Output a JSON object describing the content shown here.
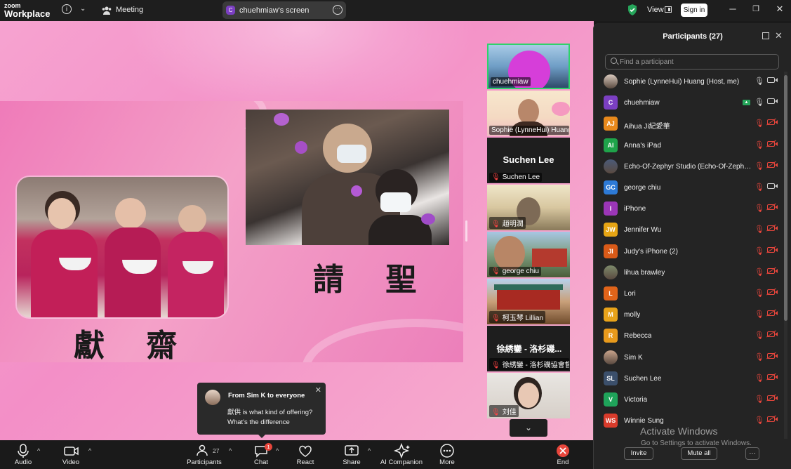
{
  "titlebar": {
    "logo_top": "zoom",
    "logo_bottom": "Workplace",
    "meeting_label": "Meeting",
    "screen_owner_initial": "C",
    "screen_label": "chuehmiaw's screen",
    "view_label": "View",
    "signin_label": "Sign in"
  },
  "slide": {
    "caption_left": "獻 齋",
    "caption_right": "請 聖"
  },
  "video_tiles": [
    {
      "name": "chuehmiaw",
      "muted": false
    },
    {
      "name": "Sophie (LynneHui) Huang",
      "muted": false
    },
    {
      "name": "Suchen Lee",
      "muted": true,
      "big_text": "Suchen Lee"
    },
    {
      "name": "趙明潤",
      "muted": true
    },
    {
      "name": "george chiu",
      "muted": true
    },
    {
      "name": "柯玉琴 Lillian",
      "muted": true
    },
    {
      "name": "徐綉鑾 - 洛杉磯協會督...",
      "muted": true,
      "big_text": "徐綉鑾 - 洛杉磯..."
    },
    {
      "name": "刘佳",
      "muted": true
    }
  ],
  "chat_toast": {
    "from": "From Sim K to everyone",
    "message": "獻供 is what kind of offering? What's the difference"
  },
  "toolbar": {
    "audio": "Audio",
    "video": "Video",
    "participants": "Participants",
    "participants_count": "27",
    "chat": "Chat",
    "chat_badge": "1",
    "react": "React",
    "share": "Share",
    "ai_companion": "AI Companion",
    "more": "More",
    "end": "End"
  },
  "participants_panel": {
    "title": "Participants (27)",
    "search_placeholder": "Find a participant",
    "invite": "Invite",
    "mute_all": "Mute all",
    "more": "···",
    "items": [
      {
        "initials": "",
        "name": "Sophie (LynneHui) Huang (Host, me)",
        "color": "#d9c9bd",
        "photo": true,
        "mic": "on",
        "cam": "on"
      },
      {
        "initials": "C",
        "name": "chuehmiaw",
        "color": "#7b3fc2",
        "mic": "on",
        "cam": "on",
        "sharing": true
      },
      {
        "initials": "AJ",
        "name": "Aihua Ji紀愛華",
        "color": "#e8891c",
        "mic": "off",
        "cam": "off"
      },
      {
        "initials": "AI",
        "name": "Anna's iPad",
        "color": "#1fa34a",
        "mic": "off",
        "cam": "off"
      },
      {
        "initials": "",
        "name": "Echo-Of-Zephyr Studio (Echo-Of-Zephyr Studio)",
        "color": "#4a5a78",
        "photo": true,
        "mic": "off",
        "cam": "off"
      },
      {
        "initials": "GC",
        "name": "george chiu",
        "color": "#2d7ad6",
        "mic": "off",
        "cam": "on"
      },
      {
        "initials": "I",
        "name": "iPhone",
        "color": "#9b36b7",
        "mic": "off",
        "cam": "off"
      },
      {
        "initials": "JW",
        "name": "Jennifer Wu",
        "color": "#e6a514",
        "mic": "off",
        "cam": "off"
      },
      {
        "initials": "JI",
        "name": "Judy's iPhone (2)",
        "color": "#d95a18",
        "mic": "off",
        "cam": "off"
      },
      {
        "initials": "",
        "name": "lihua brawley",
        "color": "#7d8a6b",
        "photo": true,
        "mic": "off",
        "cam": "off"
      },
      {
        "initials": "L",
        "name": "Lori",
        "color": "#e0641a",
        "mic": "off",
        "cam": "off"
      },
      {
        "initials": "M",
        "name": "molly",
        "color": "#e8a31a",
        "mic": "off",
        "cam": "off"
      },
      {
        "initials": "R",
        "name": "Rebecca",
        "color": "#e89a1c",
        "mic": "off",
        "cam": "off"
      },
      {
        "initials": "",
        "name": "Sim K",
        "color": "#c9a48c",
        "photo": true,
        "mic": "off",
        "cam": "off"
      },
      {
        "initials": "SL",
        "name": "Suchen Lee",
        "color": "#3b4f6b",
        "mic": "off",
        "cam": "off"
      },
      {
        "initials": "V",
        "name": "Victoria",
        "color": "#1fa35a",
        "mic": "off",
        "cam": "off"
      },
      {
        "initials": "WS",
        "name": "Winnie Sung",
        "color": "#d93b2b",
        "mic": "off",
        "cam": "off"
      }
    ]
  },
  "watermark": {
    "line1": "Activate Windows",
    "line2": "Go to Settings to activate Windows."
  }
}
